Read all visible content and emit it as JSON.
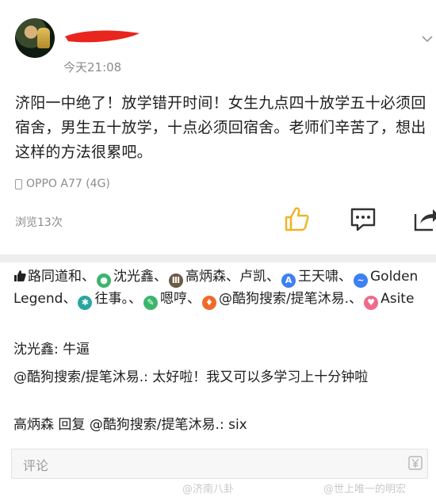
{
  "post": {
    "timestamp": "今天21:08",
    "text": "济阳一中绝了！放学错开时间！女生九点四十放学五十必须回宿舍，男生五十放学，十点必须回宿舍。老师们辛苦了，想出这样的方法很累吧。",
    "device": "OPPO A77 (4G)",
    "views": "浏览13次"
  },
  "likes": {
    "names": [
      "路同道和",
      "沈光鑫",
      "高炳森",
      "卢凯",
      "王天啸",
      "Golden Legend",
      "往事。",
      "嗯哼",
      "@酷狗搜索/提笔沐易.",
      "Asite"
    ],
    "separators": [
      "、",
      "、",
      "、",
      "、",
      "、",
      "、",
      "、",
      "、",
      "、",
      ""
    ]
  },
  "comments": [
    {
      "author": "沈光鑫",
      "sep": ": ",
      "text": "牛逼"
    },
    {
      "author": "@酷狗搜索/提笔沐易.",
      "sep": ": ",
      "text": "太好啦！我又可以多学习上十分钟啦"
    },
    {
      "author": "高炳森",
      "sep": " 回复 ",
      "target": "@酷狗搜索/提笔沐易.",
      "text": ": six"
    }
  ],
  "comment_bar": {
    "placeholder": "评论"
  },
  "watermarks": [
    "@济南八卦",
    "@世上唯一的明宏"
  ],
  "colors": {
    "like_yellow": "#f0b323",
    "redaction": "#e8261e",
    "badge_green": "#3cb56b",
    "badge_brown": "#6b5a45",
    "badge_blue": "#3d7ff5",
    "badge_teal": "#2aa6a0",
    "badge_orange": "#ef6a2a",
    "badge_pink": "#ef6a8a"
  }
}
